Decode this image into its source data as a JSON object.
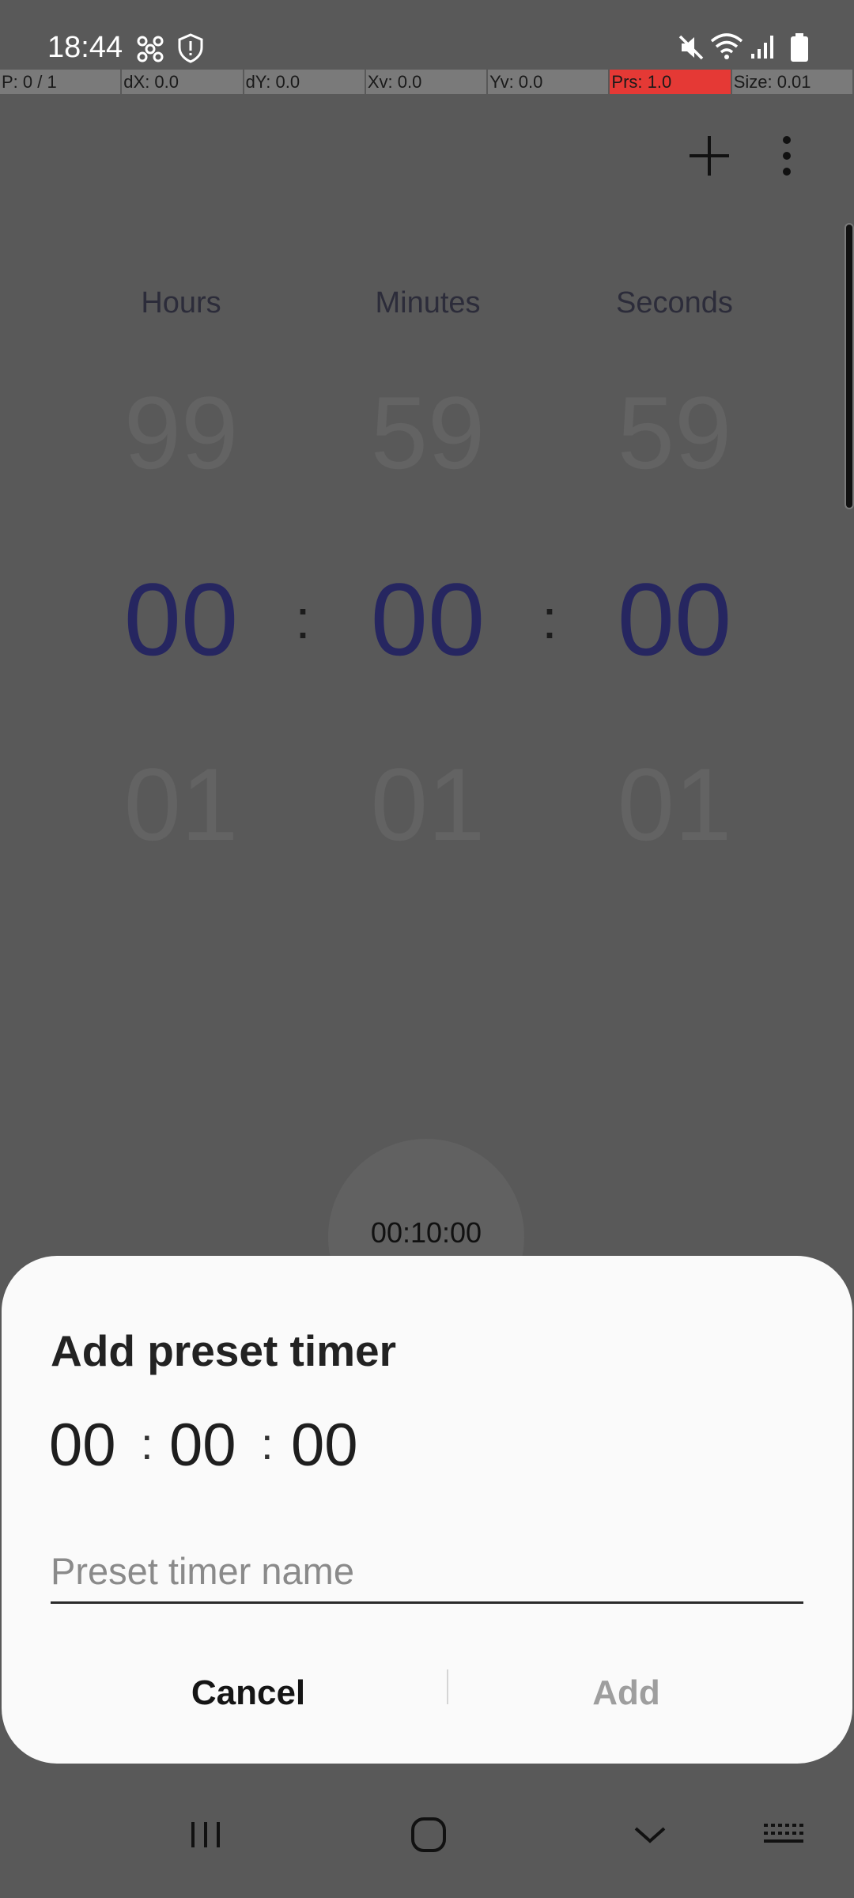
{
  "status_bar": {
    "time": "18:44",
    "icons": [
      "settings-fan-icon",
      "security-icon",
      "mute-icon",
      "wifi-icon",
      "signal-icon",
      "battery-icon"
    ]
  },
  "debug_bar": {
    "cells": [
      "P: 0 / 1",
      "dX: 0.0",
      "dY: 0.0",
      "Xv: 0.0",
      "Yv: 0.0",
      "Prs: 1.0",
      "Size: 0.01"
    ],
    "highlight_color": "#e53935"
  },
  "toolbar": {
    "add_icon": "plus-icon",
    "more_icon": "more-vert-icon"
  },
  "picker": {
    "labels": {
      "hours": "Hours",
      "minutes": "Minutes",
      "seconds": "Seconds"
    },
    "previous": {
      "hours": "99",
      "minutes": "59",
      "seconds": "59"
    },
    "current": {
      "hours": "00",
      "minutes": "00",
      "seconds": "00"
    },
    "next": {
      "hours": "01",
      "minutes": "01",
      "seconds": "01"
    },
    "separator": ":",
    "accent_color": "#262660"
  },
  "preset": {
    "label": "00:10:00"
  },
  "dialog": {
    "title": "Add preset timer",
    "hours": "00",
    "minutes": "00",
    "seconds": "00",
    "separator": ":",
    "name_placeholder": "Preset timer name",
    "name_value": "",
    "cancel_label": "Cancel",
    "add_label": "Add"
  },
  "nav_bar": {
    "icons": [
      "recent-apps-icon",
      "home-icon",
      "back-icon",
      "keyboard-icon"
    ]
  }
}
